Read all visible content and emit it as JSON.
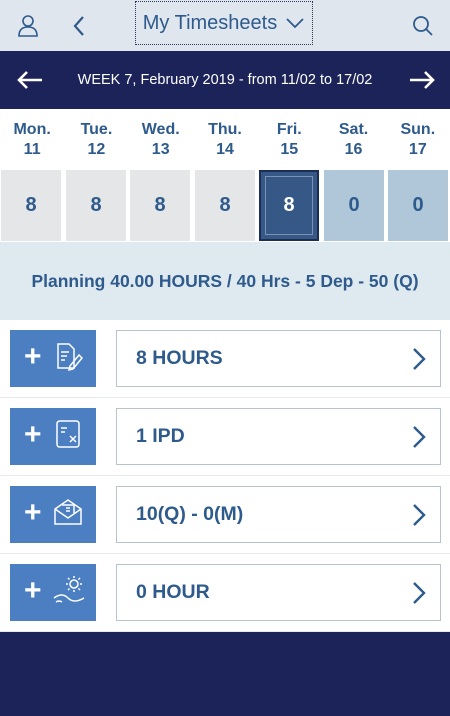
{
  "header": {
    "title": "My Timesheets",
    "icons": [
      "user-icon",
      "back-chevron-icon",
      "dropdown-chevron-icon",
      "search-icon"
    ]
  },
  "week": {
    "label": "WEEK 7, February 2019 - from 11/02 to 17/02"
  },
  "days": [
    {
      "name": "Mon.",
      "date": "11",
      "hours": "8",
      "type": "work"
    },
    {
      "name": "Tue.",
      "date": "12",
      "hours": "8",
      "type": "work"
    },
    {
      "name": "Wed.",
      "date": "13",
      "hours": "8",
      "type": "work"
    },
    {
      "name": "Thu.",
      "date": "14",
      "hours": "8",
      "type": "work"
    },
    {
      "name": "Fri.",
      "date": "15",
      "hours": "8",
      "type": "selected"
    },
    {
      "name": "Sat.",
      "date": "16",
      "hours": "0",
      "type": "weekend"
    },
    {
      "name": "Sun.",
      "date": "17",
      "hours": "0",
      "type": "weekend"
    }
  ],
  "planning": {
    "text": "Planning 40.00 HOURS / 40 Hrs - 5 Dep - 50 (Q)"
  },
  "entries": [
    {
      "label": "8 HOURS",
      "icon": "timesheet-edit-icon"
    },
    {
      "label": "1 IPD",
      "icon": "expense-receipt-icon"
    },
    {
      "label": "10(Q) - 0(M)",
      "icon": "envelope-money-icon"
    },
    {
      "label": "0 HOUR",
      "icon": "vacation-sun-icon"
    }
  ],
  "colors": {
    "navy": "#1c2358",
    "text_blue": "#2e5a8c",
    "button_blue": "#4b7fc1",
    "selected_day": "#355887",
    "weekend_day": "#afc7d8",
    "planning_bg": "#dfeaf0"
  }
}
